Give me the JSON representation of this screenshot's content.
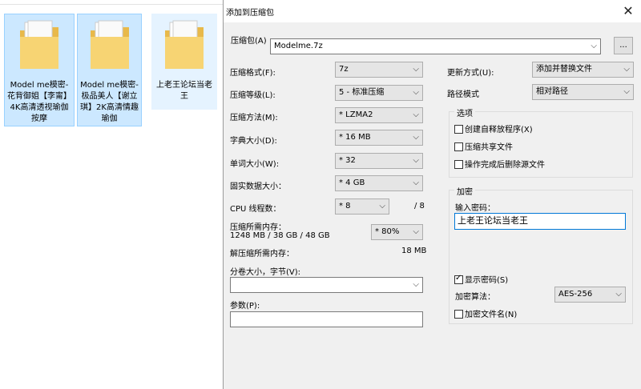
{
  "explorer": {
    "folders": [
      {
        "name": "Model me模密-花背御姐【李甯】4K高清透视瑜伽按摩",
        "selected": true
      },
      {
        "name": "Model me模密-极品美人【谢立琪】2K高清情趣瑜伽",
        "selected": true
      },
      {
        "name": "上老王论坛当老王",
        "selected": false
      }
    ]
  },
  "dialog": {
    "title": "添加到压缩包",
    "close_icon": "✕",
    "archive_label": "压缩包(A)",
    "archive_value": "Modelme.7z",
    "browse_label": "...",
    "format_label": "压缩格式(F):",
    "format_value": "7z",
    "level_label": "压缩等级(L):",
    "level_value": "5 - 标准压缩",
    "method_label": "压缩方法(M):",
    "method_value": "* LZMA2",
    "dict_label": "字典大小(D):",
    "dict_value": "* 16 MB",
    "word_label": "单词大小(W):",
    "word_value": "* 32",
    "solid_label": "固实数据大小：",
    "solid_value": "* 4 GB",
    "threads_label": "CPU 线程数：",
    "threads_value": "* 8",
    "threads_total": "/ 8",
    "mem_label": "压缩所需内存：",
    "mem_value": "1248 MB / 38 GB / 48 GB",
    "mem_percent": "* 80%",
    "decomp_label": "解压缩所需内存：",
    "decomp_value": "18 MB",
    "split_label": "分卷大小，字节(V):",
    "split_value": "",
    "params_label": "参数(P):",
    "params_value": "",
    "update_label": "更新方式(U):",
    "update_value": "添加并替换文件",
    "path_label": "路径模式",
    "path_value": "相对路径",
    "options": {
      "title": "选项",
      "sfx": "创建自释放程序(X)",
      "shared": "压缩共享文件",
      "delete": "操作完成后删除源文件"
    },
    "encryption": {
      "title": "加密",
      "password_label": "输入密码：",
      "password_value": "上老王论坛当老王",
      "show_password": "显示密码(S)",
      "algo_label": "加密算法：",
      "algo_value": "AES-256",
      "encrypt_names": "加密文件名(N)"
    }
  }
}
